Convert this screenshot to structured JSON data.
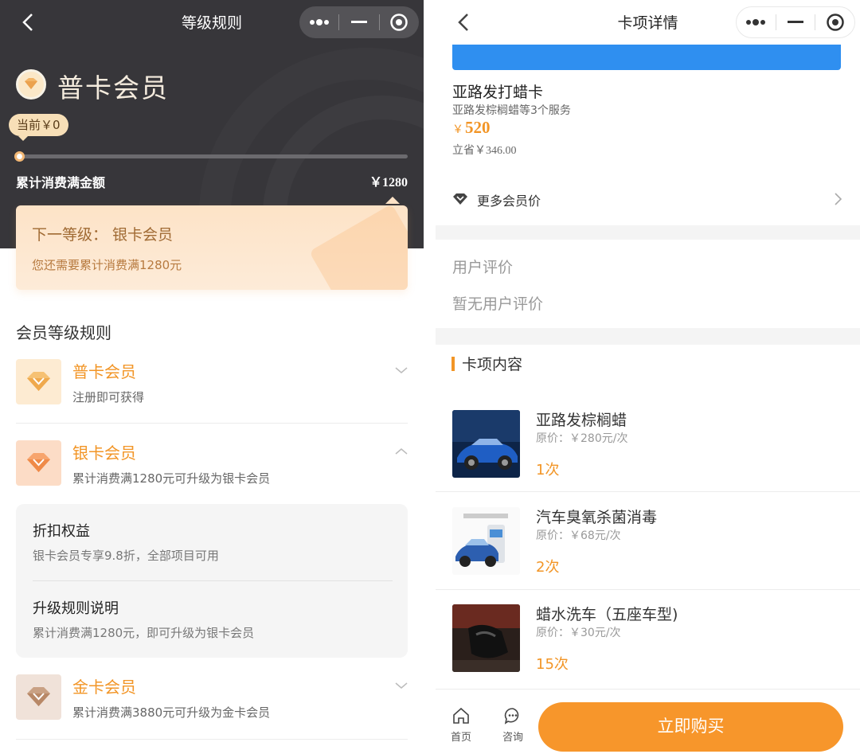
{
  "left": {
    "nav": {
      "title": "等级规则"
    },
    "header": {
      "level_name": "普卡会员",
      "current_tip": "当前￥0",
      "progress": {
        "current": 0,
        "target": 1280
      },
      "acc_label": "累计消费满金额",
      "acc_value": "￥1280"
    },
    "next_card": {
      "title": "下一等级：  银卡会员",
      "desc": "您还需要累计消费满1280元"
    },
    "rules_title": "会员等级规则",
    "levels": [
      {
        "name": "普卡会员",
        "desc": "注册即可获得",
        "expanded": false
      },
      {
        "name": "银卡会员",
        "desc": "累计消费满1280元可升级为银卡会员",
        "expanded": true
      },
      {
        "name": "金卡会员",
        "desc": "累计消费满3880元可升级为金卡会员",
        "expanded": false
      }
    ],
    "benefits": [
      {
        "title": "折扣权益",
        "desc": "银卡会员专享9.8折，全部项目可用"
      },
      {
        "title": "升级规则说明",
        "desc": "累计消费满1280元，即可升级为银卡会员"
      }
    ]
  },
  "right": {
    "nav": {
      "title": "卡项详情"
    },
    "card": {
      "name": "亚路发打蜡卡",
      "sub": "亚路发棕榈蜡等3个服务",
      "price_symbol": "￥",
      "price": "520",
      "save": "立省￥346.00"
    },
    "more_member_price": "更多会员价",
    "review": {
      "title": "用户评价",
      "empty": "暂无用户评价"
    },
    "content_title": "卡项内容",
    "items": [
      {
        "name": "亚路发棕榈蜡",
        "price": "原价：￥280元/次",
        "count": "1次"
      },
      {
        "name": "汽车臭氧杀菌消毒",
        "price": "原价：￥68元/次",
        "count": "2次"
      },
      {
        "name": "蜡水洗车（五座车型)",
        "price": "原价：￥30元/次",
        "count": "15次"
      }
    ],
    "bottom": {
      "home_label": "首页",
      "consult_label": "咨询",
      "buy_label": "立即购买"
    }
  },
  "colors": {
    "accent": "#f29526",
    "dark_header": "#37363a",
    "banner_blue": "#2f8ff0",
    "buy_button": "#f7962b"
  },
  "icons": [
    "back-icon",
    "more-dots-icon",
    "minimize-icon",
    "target-icon",
    "diamond-icon",
    "chevron-down-icon",
    "chevron-up-icon",
    "chevron-right-icon",
    "home-icon",
    "chat-icon"
  ]
}
